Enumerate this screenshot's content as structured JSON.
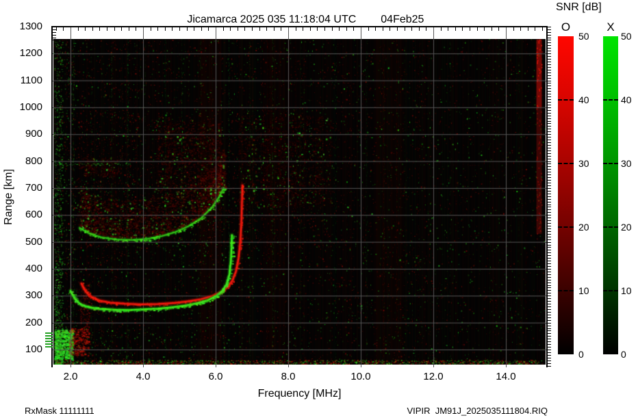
{
  "header": {
    "title": "Jicamarca 2025 035 11:18:04 UTC",
    "date": "04Feb25"
  },
  "footer": {
    "left": "RxMask 11111111",
    "right": "VIPIR  JM91J_2025035111804.RIQ"
  },
  "colorbar": {
    "title": "SNR [dB]",
    "bars": [
      {
        "label": "O",
        "top_color": "#ff0000"
      },
      {
        "label": "X",
        "top_color": "#00dd00"
      }
    ],
    "ticks": [
      50,
      40,
      30,
      20,
      10,
      0
    ],
    "dash_ticks": [
      40,
      30,
      20,
      10
    ],
    "range": [
      0,
      50
    ]
  },
  "chart_data": {
    "type": "heatmap",
    "title": "Jicamarca 2025 035 11:18:04 UTC",
    "subtitle": "04Feb25",
    "xlabel": "Frequency [MHz]",
    "ylabel": "Range [km]",
    "x_major_ticks": [
      2,
      4,
      6,
      8,
      10,
      12,
      14
    ],
    "x_tick_labels": [
      "2.0",
      "4.0",
      "6.0",
      "8.0",
      "10.0",
      "12.0",
      "14.0"
    ],
    "x_minor_step": 0.2,
    "y_major_ticks": [
      100,
      200,
      300,
      400,
      500,
      600,
      700,
      800,
      900,
      1000,
      1100,
      1200,
      1300
    ],
    "y_minor_step": 10,
    "xlim": [
      1.53,
      15.09
    ],
    "ylim_km": [
      44,
      1254
    ],
    "grid": true,
    "grid_color": "#565656",
    "snr_scale": [
      0,
      50
    ],
    "o_color": "#ee1100",
    "x_color": "#00dd00",
    "traces": {
      "o_mode": [
        [
          2.3,
          345
        ],
        [
          2.42,
          315
        ],
        [
          2.58,
          295
        ],
        [
          2.8,
          282
        ],
        [
          3.1,
          274
        ],
        [
          3.5,
          270
        ],
        [
          3.95,
          268
        ],
        [
          4.4,
          269
        ],
        [
          4.85,
          273
        ],
        [
          5.25,
          279
        ],
        [
          5.6,
          287
        ],
        [
          5.9,
          298
        ],
        [
          6.15,
          313
        ],
        [
          6.33,
          332
        ],
        [
          6.46,
          356
        ],
        [
          6.56,
          390
        ],
        [
          6.63,
          438
        ],
        [
          6.68,
          500
        ],
        [
          6.71,
          575
        ],
        [
          6.73,
          665
        ],
        [
          6.74,
          710
        ]
      ],
      "x_mode": [
        [
          2.0,
          318
        ],
        [
          2.12,
          288
        ],
        [
          2.28,
          268
        ],
        [
          2.5,
          257
        ],
        [
          2.8,
          251
        ],
        [
          3.2,
          248
        ],
        [
          3.6,
          247
        ],
        [
          4.0,
          249
        ],
        [
          4.4,
          252
        ],
        [
          4.8,
          257
        ],
        [
          5.15,
          263
        ],
        [
          5.5,
          272
        ],
        [
          5.8,
          284
        ],
        [
          6.02,
          299
        ],
        [
          6.18,
          317
        ],
        [
          6.3,
          342
        ],
        [
          6.38,
          378
        ],
        [
          6.42,
          430
        ],
        [
          6.44,
          490
        ],
        [
          6.45,
          525
        ]
      ],
      "second_hop": [
        [
          2.25,
          552
        ],
        [
          2.5,
          532
        ],
        [
          2.85,
          517
        ],
        [
          3.25,
          509
        ],
        [
          3.7,
          507
        ],
        [
          4.1,
          511
        ],
        [
          4.5,
          521
        ],
        [
          4.9,
          537
        ],
        [
          5.25,
          558
        ],
        [
          5.6,
          588
        ],
        [
          5.9,
          628
        ],
        [
          6.1,
          668
        ],
        [
          6.22,
          700
        ]
      ]
    },
    "clouds": [
      {
        "path": "second_hop",
        "offset_km": [
          8,
          150
        ],
        "n": 2600,
        "alpha": 0.16,
        "green_frac": 0.06
      },
      {
        "f": [
          4.4,
          6.15
        ],
        "km": [
          690,
          950
        ],
        "n": 1000,
        "alpha": 0.14,
        "green_frac": 0.05
      },
      {
        "f": [
          6.6,
          9.2
        ],
        "km": [
          630,
          970
        ],
        "n": 1200,
        "alpha": 0.1,
        "green_frac": 0.05
      },
      {
        "f": [
          2.3,
          3.3
        ],
        "km": [
          745,
          815
        ],
        "n": 280,
        "alpha": 0.1,
        "green_frac": 0.04
      }
    ],
    "clutter": [
      {
        "f": [
          1.55,
          1.78
        ],
        "km": [
          44,
          1252
        ],
        "n": 900,
        "color": "green",
        "alpha": [
          0.15,
          0.7
        ],
        "size": [
          1,
          2
        ],
        "km_pow": 2.0
      },
      {
        "f": [
          1.55,
          2.05
        ],
        "km": [
          65,
          175
        ],
        "n": 420,
        "color": "green",
        "alpha": [
          0.4,
          1.0
        ],
        "size": [
          1.5,
          4
        ],
        "km_pow": 1
      },
      {
        "f": [
          1.95,
          2.5
        ],
        "km": [
          80,
          180
        ],
        "n": 300,
        "color": "red",
        "alpha": [
          0.2,
          0.6
        ],
        "size": [
          1.5,
          3
        ],
        "km_pow": 1
      },
      {
        "f": [
          2.26,
          2.52
        ],
        "km": [
          170,
          345
        ],
        "n": 200,
        "color": "red",
        "alpha": [
          0.12,
          0.4
        ],
        "size": [
          1,
          2.5
        ],
        "km_pow": 1
      },
      {
        "f": [
          1.55,
          15.0
        ],
        "km": [
          44,
          62
        ],
        "n": 1500,
        "color": "mix",
        "alpha": [
          0.2,
          0.8
        ],
        "size": [
          1,
          2
        ],
        "km_pow": 1
      }
    ],
    "hline": {
      "km": 790,
      "f": [
        1.55,
        3.65
      ],
      "color": "green",
      "alpha": 0.5
    },
    "rfi": {
      "green_stripes": [
        [
          2.07,
          0.45
        ],
        [
          2.56,
          0.2
        ],
        [
          3.12,
          0.3
        ],
        [
          3.57,
          0.3
        ],
        [
          4.05,
          0.18
        ],
        [
          4.6,
          0.15
        ],
        [
          5.06,
          0.25
        ],
        [
          5.57,
          0.2
        ],
        [
          6.36,
          0.3
        ],
        [
          6.92,
          0.22
        ],
        [
          7.56,
          0.28
        ],
        [
          8.35,
          0.15
        ],
        [
          9.3,
          0.14
        ],
        [
          10.15,
          0.16
        ],
        [
          11.2,
          0.12
        ],
        [
          12.45,
          0.16
        ],
        [
          13.55,
          0.1
        ],
        [
          14.35,
          0.12
        ]
      ],
      "red_stripes": [
        [
          4.72,
          0.15
        ],
        [
          5.88,
          0.2
        ],
        [
          7.42,
          0.18
        ],
        [
          8.18,
          0.15
        ],
        [
          9.62,
          0.12
        ],
        [
          10.62,
          0.25
        ],
        [
          10.98,
          0.2
        ],
        [
          11.58,
          0.15
        ],
        [
          12.82,
          0.12
        ],
        [
          13.92,
          0.12
        ],
        [
          14.55,
          0.15
        ]
      ],
      "red_bands": [
        {
          "f": [
            5.55,
            6.15
          ],
          "alpha": 0.06
        },
        {
          "f": [
            10.4,
            11.15
          ],
          "alpha": 0.05
        },
        {
          "f": [
            7.3,
            7.95
          ],
          "alpha": 0.04
        }
      ],
      "right_edge": {
        "f": [
          14.84,
          14.99
        ],
        "segments": [
          {
            "km": [
              1000,
              1252
            ],
            "alpha": 0.85
          },
          {
            "km": [
              530,
              1000
            ],
            "alpha": 0.4
          }
        ]
      }
    },
    "noise": {
      "seed": 20250204,
      "red_attempts": 15000,
      "green_attempts": 6500,
      "column_red_prob": 0.5,
      "column_green_prob": 0.12,
      "density_regions_red": [
        {
          "f": [
            1.55,
            3.8
          ],
          "km": [
            44,
            1252
          ],
          "mul": 1.8
        },
        {
          "f": [
            2.2,
            9.0
          ],
          "km": [
            480,
            980
          ],
          "mul": 2.2
        },
        {
          "f": [
            12.0,
            15.05
          ],
          "km": [
            44,
            1252
          ],
          "mul": 0.55
        }
      ],
      "density_regions_green": [
        {
          "f": [
            1.55,
            2.15
          ],
          "km": [
            44,
            1252
          ],
          "mul": 3.0
        },
        {
          "f": [
            2.2,
            6.4
          ],
          "km": [
            470,
            720
          ],
          "mul": 2.2
        },
        {
          "f": [
            1.55,
            5.5
          ],
          "km": [
            44,
            180
          ],
          "mul": 2.0
        },
        {
          "f": [
            6.5,
            9.2
          ],
          "km": [
            600,
            1000
          ],
          "mul": 1.8
        }
      ]
    },
    "axis_artifacts": {
      "green_dash_km": [
        110,
        120,
        130,
        140,
        150,
        160
      ],
      "corner_tick_km": [
        1250,
        1260,
        1270,
        1280,
        1290
      ]
    }
  }
}
